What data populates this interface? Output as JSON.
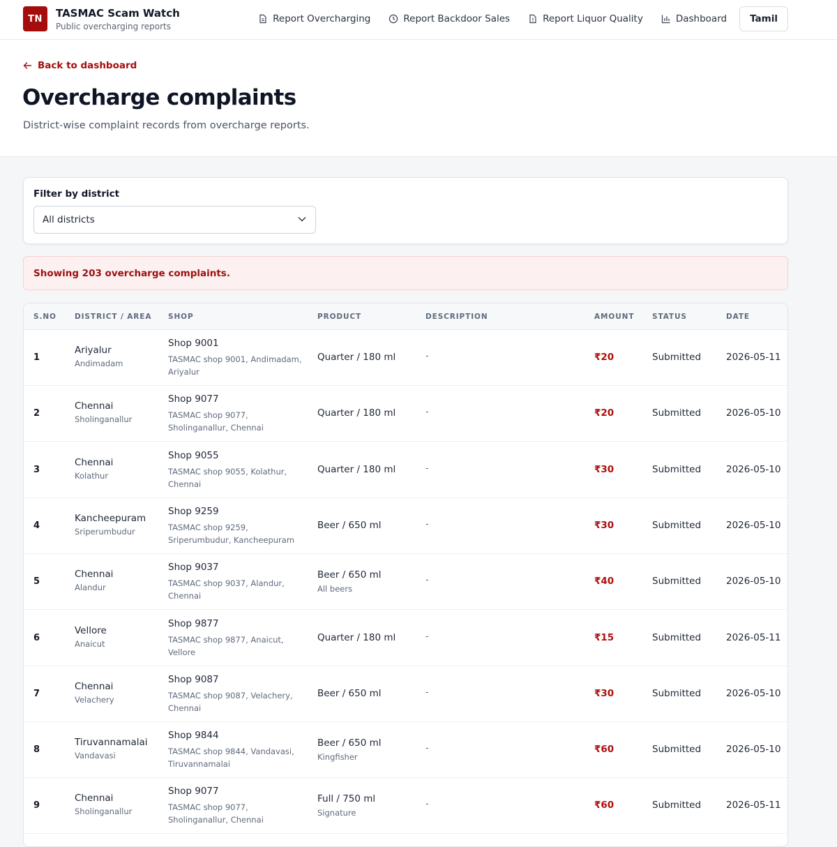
{
  "header": {
    "logo_text": "TN",
    "brand_title": "TASMAC Scam Watch",
    "brand_subtitle": "Public overcharging reports",
    "nav": [
      {
        "label": "Report Overcharging",
        "icon": "document-icon"
      },
      {
        "label": "Report Backdoor Sales",
        "icon": "clock-icon"
      },
      {
        "label": "Report Liquor Quality",
        "icon": "alert-document-icon"
      },
      {
        "label": "Dashboard",
        "icon": "bar-chart-icon"
      }
    ],
    "language_button": "Tamil"
  },
  "hero": {
    "back_label": "Back to dashboard",
    "title": "Overcharge complaints",
    "subtitle": "District-wise complaint records from overcharge reports."
  },
  "filter": {
    "label": "Filter by district",
    "selected": "All districts"
  },
  "alert": {
    "text": "Showing 203 overcharge complaints."
  },
  "colors": {
    "brand": "#a50d0d",
    "amount": "#b00d0d",
    "alert_bg": "#fdf0f0"
  },
  "table": {
    "columns": [
      "S.NO",
      "DISTRICT / AREA",
      "SHOP",
      "PRODUCT",
      "DESCRIPTION",
      "AMOUNT",
      "STATUS",
      "DATE"
    ],
    "rows": [
      {
        "sno": "1",
        "district": "Ariyalur",
        "area": "Andimadam",
        "shop": "Shop 9001",
        "shop_addr_1": "TASMAC shop 9001, Andimadam,",
        "shop_addr_2": "Ariyalur",
        "product": "Quarter / 180 ml",
        "product_note": "",
        "description": "-",
        "amount": "₹20",
        "status": "Submitted",
        "date": "2026-05-11"
      },
      {
        "sno": "2",
        "district": "Chennai",
        "area": "Sholinganallur",
        "shop": "Shop 9077",
        "shop_addr_1": "TASMAC shop 9077,",
        "shop_addr_2": "Sholinganallur, Chennai",
        "product": "Quarter / 180 ml",
        "product_note": "",
        "description": "-",
        "amount": "₹20",
        "status": "Submitted",
        "date": "2026-05-10"
      },
      {
        "sno": "3",
        "district": "Chennai",
        "area": "Kolathur",
        "shop": "Shop 9055",
        "shop_addr_1": "TASMAC shop 9055, Kolathur,",
        "shop_addr_2": "Chennai",
        "product": "Quarter / 180 ml",
        "product_note": "",
        "description": "-",
        "amount": "₹30",
        "status": "Submitted",
        "date": "2026-05-10"
      },
      {
        "sno": "4",
        "district": "Kancheepuram",
        "area": "Sriperumbudur",
        "shop": "Shop 9259",
        "shop_addr_1": "TASMAC shop 9259,",
        "shop_addr_2": "Sriperumbudur, Kancheepuram",
        "product": "Beer / 650 ml",
        "product_note": "",
        "description": "-",
        "amount": "₹30",
        "status": "Submitted",
        "date": "2026-05-10"
      },
      {
        "sno": "5",
        "district": "Chennai",
        "area": "Alandur",
        "shop": "Shop 9037",
        "shop_addr_1": "TASMAC shop 9037, Alandur,",
        "shop_addr_2": "Chennai",
        "product": "Beer / 650 ml",
        "product_note": "All beers",
        "description": "-",
        "amount": "₹40",
        "status": "Submitted",
        "date": "2026-05-10"
      },
      {
        "sno": "6",
        "district": "Vellore",
        "area": "Anaicut",
        "shop": "Shop 9877",
        "shop_addr_1": "TASMAC shop 9877, Anaicut,",
        "shop_addr_2": "Vellore",
        "product": "Quarter / 180 ml",
        "product_note": "",
        "description": "-",
        "amount": "₹15",
        "status": "Submitted",
        "date": "2026-05-11"
      },
      {
        "sno": "7",
        "district": "Chennai",
        "area": "Velachery",
        "shop": "Shop 9087",
        "shop_addr_1": "TASMAC shop 9087, Velachery,",
        "shop_addr_2": "Chennai",
        "product": "Beer / 650 ml",
        "product_note": "",
        "description": "-",
        "amount": "₹30",
        "status": "Submitted",
        "date": "2026-05-10"
      },
      {
        "sno": "8",
        "district": "Tiruvannamalai",
        "area": "Vandavasi",
        "shop": "Shop 9844",
        "shop_addr_1": "TASMAC shop 9844, Vandavasi,",
        "shop_addr_2": "Tiruvannamalai",
        "product": "Beer / 650 ml",
        "product_note": "Kingfisher",
        "description": "-",
        "amount": "₹60",
        "status": "Submitted",
        "date": "2026-05-10"
      },
      {
        "sno": "9",
        "district": "Chennai",
        "area": "Sholinganallur",
        "shop": "Shop 9077",
        "shop_addr_1": "TASMAC shop 9077,",
        "shop_addr_2": "Sholinganallur, Chennai",
        "product": "Full / 750 ml",
        "product_note": "Signature",
        "description": "-",
        "amount": "₹60",
        "status": "Submitted",
        "date": "2026-05-11"
      }
    ]
  }
}
